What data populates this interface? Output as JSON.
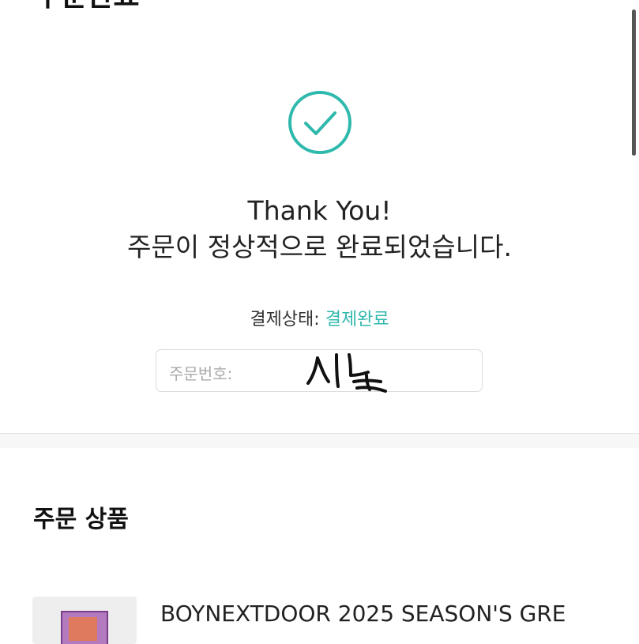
{
  "header": {
    "title": "주문완료"
  },
  "confirmation": {
    "thank_you": "Thank You!",
    "message": "주문이 정상적으로 완료되었습니다.",
    "payment_status_label": "결제상태:",
    "payment_status_value": "결제완료",
    "order_number_label": "주문번호:",
    "accent_color": "#2fb9ac",
    "icon": "check-circle-icon"
  },
  "order_items": {
    "title": "주문 상품",
    "items": [
      {
        "name": "BOYNEXTDOOR 2025 SEASON'S GRE"
      }
    ]
  }
}
